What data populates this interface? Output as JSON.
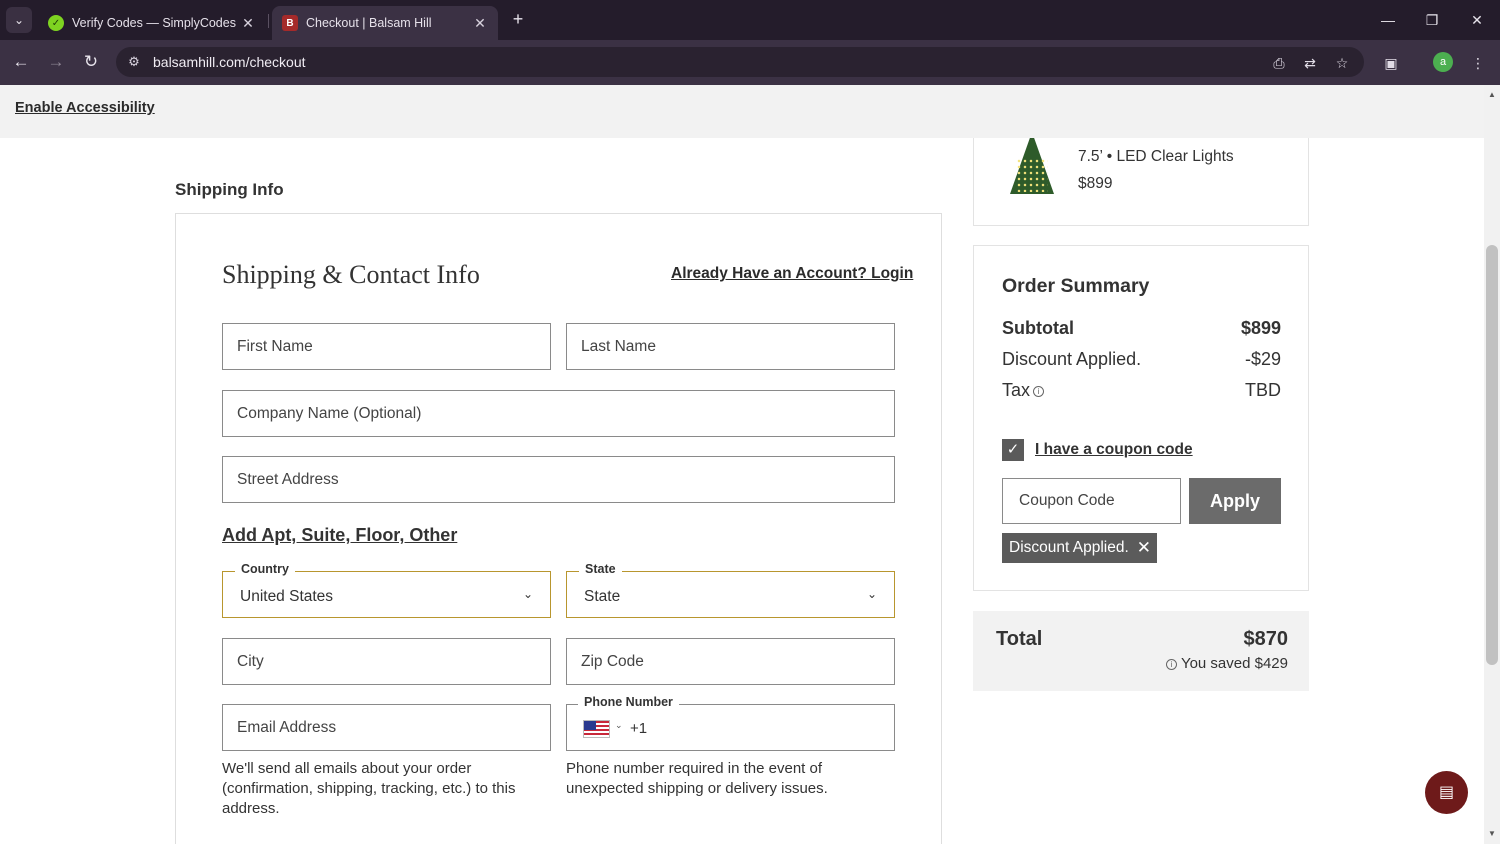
{
  "browser": {
    "tabs": [
      {
        "title": "Verify Codes — SimplyCodes",
        "active": false
      },
      {
        "title": "Checkout | Balsam Hill",
        "active": true
      }
    ],
    "url": "balsamhill.com/checkout",
    "profile_initial": "a"
  },
  "page": {
    "accessibility_link": "Enable Accessibility",
    "section_title": "Shipping Info"
  },
  "form": {
    "heading": "Shipping & Contact Info",
    "login_link": "Already Have an Account? Login",
    "first_name_placeholder": "First Name",
    "last_name_placeholder": "Last Name",
    "company_placeholder": "Company Name (Optional)",
    "street_placeholder": "Street Address",
    "apt_link": "Add Apt, Suite, Floor, Other",
    "country": {
      "label": "Country",
      "value": "United States"
    },
    "state": {
      "label": "State",
      "value": "State"
    },
    "city_placeholder": "City",
    "zip_placeholder": "Zip Code",
    "email_placeholder": "Email Address",
    "phone": {
      "label": "Phone Number",
      "code": "+1"
    },
    "email_help": "We'll send all emails about your order (confirmation, shipping, tracking, etc.) to this address.",
    "phone_help": "Phone number required in the event of unexpected shipping or delivery issues."
  },
  "product": {
    "variant": "7.5’ • LED Clear Lights",
    "price": "$899"
  },
  "summary": {
    "title": "Order Summary",
    "subtotal_label": "Subtotal",
    "subtotal_value": "$899",
    "discount_label": "Discount Applied.",
    "discount_value": "-$29",
    "tax_label": "Tax",
    "tax_value": "TBD",
    "coupon_checkbox_label": "I have a coupon code",
    "coupon_placeholder": "Coupon Code",
    "apply_label": "Apply",
    "discount_chip": "Discount Applied."
  },
  "total": {
    "label": "Total",
    "value": "$870",
    "saved": "You saved $429"
  }
}
